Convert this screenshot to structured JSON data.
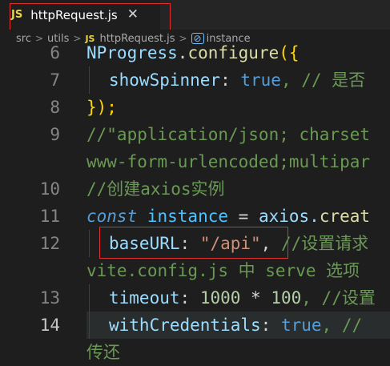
{
  "tab": {
    "lang": "JS",
    "filename": "httpRequest.js",
    "close": "✕"
  },
  "breadcrumb": {
    "src": "src",
    "utils": "utils",
    "file_lang": "JS",
    "file": "httpRequest.js",
    "symbol_icon": "symbol-variable-icon",
    "symbol": "instance",
    "sep": ">"
  },
  "lines": {
    "l6": {
      "num": "6",
      "a": "NProgress",
      "b": ".",
      "c": "configure",
      "d": "({"
    },
    "l7": {
      "num": "7",
      "a": "showSpinner",
      "b": ": ",
      "c": "true",
      "d": ", // 是否"
    },
    "l8": {
      "num": "8",
      "a": "});"
    },
    "l9": {
      "num": "9",
      "a": "//\"application/json; charset"
    },
    "l9b": {
      "num": "",
      "a": "www-form-urlencoded;multipar"
    },
    "l10": {
      "num": "10",
      "a": "//创建axios实例"
    },
    "l11": {
      "num": "11",
      "a": "const",
      "b": " instance ",
      "c": "=",
      "d": " axios.",
      "e": "creat"
    },
    "l12": {
      "num": "12",
      "a": "baseURL",
      "b": ": ",
      "c": "\"/api\"",
      "d": ", ",
      "e": "//设置请求"
    },
    "l12b": {
      "num": "",
      "a": "vite.config.js 中 serve 选项"
    },
    "l13": {
      "num": "13",
      "a": "timeout",
      "b": ": ",
      "c": "1000",
      "d": " * ",
      "e": "100",
      "f": ", //设置"
    },
    "l14": {
      "num": "14",
      "a": "withCredentials",
      "b": ": ",
      "c": "true",
      "d": ", //"
    },
    "l14b": {
      "num": "",
      "a": "传还"
    }
  }
}
